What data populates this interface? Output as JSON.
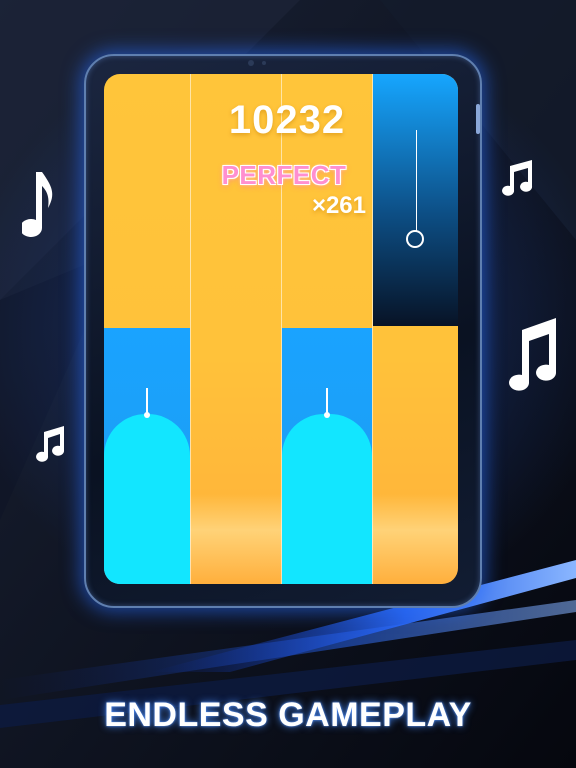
{
  "game": {
    "score": "10232",
    "judgement": "PERFECT",
    "combo": "×261"
  },
  "promo": {
    "headline": "ENDLESS GAMEPLAY"
  },
  "colors": {
    "tile_blue": "#1aa3ff",
    "hold_cyan": "#12e6ff",
    "lane_yellow": "#ffc53a",
    "perfect_pink": "#ff8fd0",
    "glow_blue": "#2a6bff"
  },
  "icons": [
    "music-note-icon",
    "music-notes-icon"
  ]
}
